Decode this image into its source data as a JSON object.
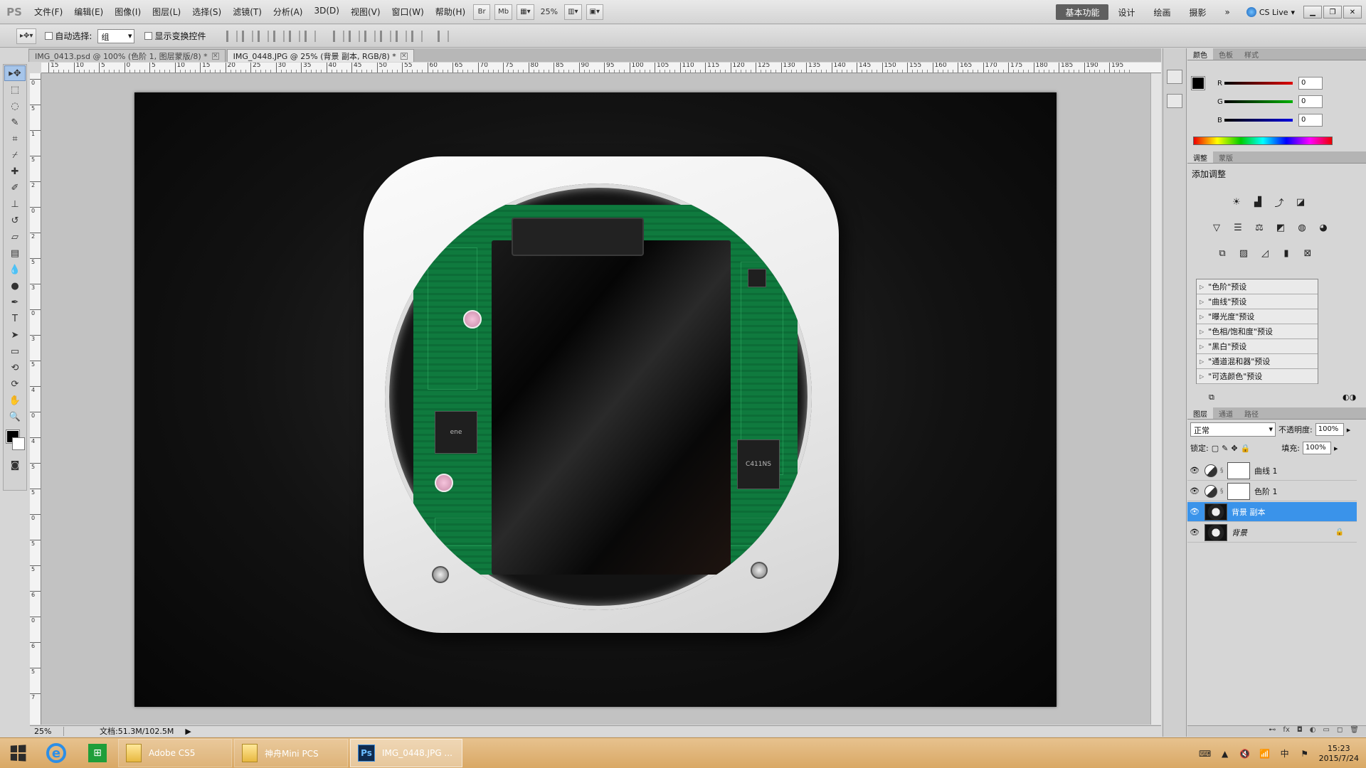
{
  "app": {
    "logo": "PS",
    "menus": [
      "文件(F)",
      "编辑(E)",
      "图像(I)",
      "图层(L)",
      "选择(S)",
      "滤镜(T)",
      "分析(A)",
      "3D(D)",
      "视图(V)",
      "窗口(W)",
      "帮助(H)"
    ],
    "bridge_btn": "Br",
    "minibridge_btn": "Mb",
    "zoom": "25%",
    "workspaces": [
      "基本功能",
      "设计",
      "绘画",
      "摄影"
    ],
    "more": "»",
    "cs_live": "CS Live",
    "window_controls": [
      "▁",
      "❐",
      "✕"
    ]
  },
  "options": {
    "auto_select_label": "自动选择:",
    "auto_select_value": "组",
    "show_transform_label": "显示变换控件"
  },
  "tabs": [
    {
      "label": "IMG_0413.psd @ 100% (色阶 1, 图层蒙版/8) *",
      "close": "✕"
    },
    {
      "label": "IMG_0448.JPG @ 25% (背景 副本, RGB/8) *",
      "close": "✕"
    }
  ],
  "ruler": {
    "top_labels": [
      "15",
      "10",
      "5",
      "0",
      "5",
      "10",
      "15",
      "20",
      "25",
      "30",
      "35",
      "40",
      "45",
      "50",
      "55",
      "60",
      "65",
      "70",
      "75",
      "80",
      "85",
      "90",
      "95",
      "100",
      "105",
      "110",
      "115",
      "120",
      "125",
      "130",
      "135",
      "140",
      "145",
      "150",
      "155",
      "160",
      "165",
      "170",
      "175",
      "180",
      "185",
      "190",
      "195"
    ],
    "left_labels": [
      "0",
      "5",
      "1",
      "5",
      "2",
      "0",
      "2",
      "5",
      "3",
      "0",
      "3",
      "5",
      "4",
      "0",
      "4",
      "5",
      "5",
      "0",
      "5",
      "5",
      "6",
      "0",
      "6",
      "5",
      "7"
    ]
  },
  "photo": {
    "chip1_text": "ene",
    "chip2_text": "C411NS"
  },
  "status": {
    "zoom": "25%",
    "doc": "文档:51.3M/102.5M"
  },
  "color_panel": {
    "tabs": [
      "颜色",
      "色板",
      "样式"
    ],
    "channels": [
      {
        "label": "R",
        "value": "0",
        "color": "#e00000"
      },
      {
        "label": "G",
        "value": "0",
        "color": "#00b000"
      },
      {
        "label": "B",
        "value": "0",
        "color": "#0000e0"
      }
    ]
  },
  "adjust_panel": {
    "tabs": [
      "调整",
      "蒙版"
    ],
    "title": "添加调整",
    "presets": [
      "\"色阶\"预设",
      "\"曲线\"预设",
      "\"曝光度\"预设",
      "\"色相/饱和度\"预设",
      "\"黑白\"预设",
      "\"通道混和器\"预设",
      "\"可选颜色\"预设"
    ]
  },
  "layers_panel": {
    "tabs": [
      "图层",
      "通道",
      "路径"
    ],
    "blend_mode": "正常",
    "opacity_label": "不透明度:",
    "opacity": "100%",
    "lock_label": "锁定:",
    "fill_label": "填充:",
    "fill": "100%",
    "layers": [
      {
        "name": "曲线 1",
        "kind": "adjustment"
      },
      {
        "name": "色阶 1",
        "kind": "adjustment"
      },
      {
        "name": "背景 副本",
        "kind": "photo",
        "selected": true
      },
      {
        "name": "背景",
        "kind": "photo",
        "locked": true
      }
    ],
    "footer_icons": [
      "⊷",
      "fx",
      "◘",
      "◐",
      "▭",
      "◻",
      "🗑"
    ]
  },
  "taskbar": {
    "items": [
      {
        "label": "Adobe CS5",
        "icon": "folder-icon"
      },
      {
        "label": "神舟Mini PCS",
        "icon": "folder-icon"
      },
      {
        "label": "IMG_0448.JPG ...",
        "icon": "photoshop-icon",
        "active": true
      }
    ],
    "ie_glyph": "e",
    "store_glyph": "⊞",
    "clock_time": "15:23",
    "clock_date": "2015/7/24",
    "ime": "中"
  }
}
